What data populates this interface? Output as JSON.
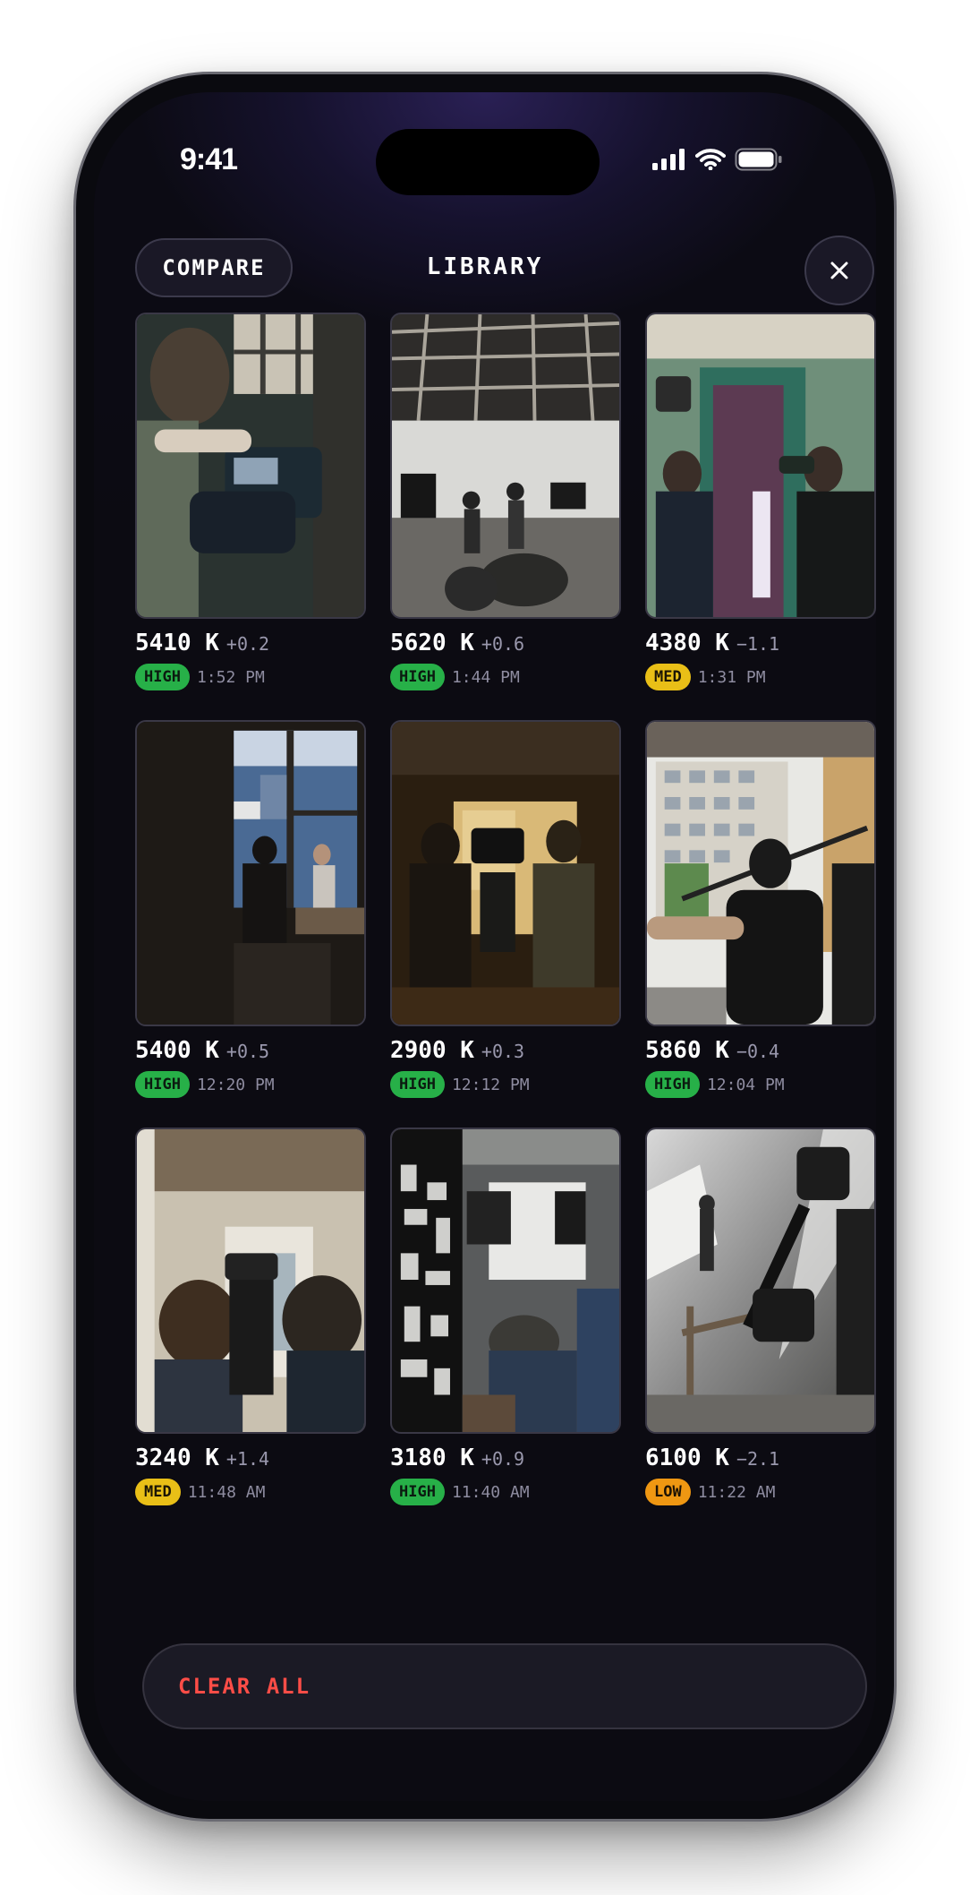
{
  "status_bar": {
    "time": "9:41"
  },
  "header": {
    "compare_label": "COMPARE",
    "title": "LIBRARY",
    "close_icon": "close-icon"
  },
  "colors": {
    "high": "#27b048",
    "med": "#e9bf17",
    "low": "#ef9712",
    "danger": "#ff4d47",
    "accent_bg": "#2a2055"
  },
  "items": [
    {
      "kelvin": "5410 K",
      "delta": "+0.2",
      "badge": "HIGH",
      "level": "high",
      "time": "1:52 PM"
    },
    {
      "kelvin": "5620 K",
      "delta": "+0.6",
      "badge": "HIGH",
      "level": "high",
      "time": "1:44 PM"
    },
    {
      "kelvin": "4380 K",
      "delta": "−1.1",
      "badge": "MED",
      "level": "med",
      "time": "1:31 PM"
    },
    {
      "kelvin": "5400 K",
      "delta": "+0.5",
      "badge": "HIGH",
      "level": "high",
      "time": "12:20 PM"
    },
    {
      "kelvin": "2900 K",
      "delta": "+0.3",
      "badge": "HIGH",
      "level": "high",
      "time": "12:12 PM"
    },
    {
      "kelvin": "5860 K",
      "delta": "−0.4",
      "badge": "HIGH",
      "level": "high",
      "time": "12:04 PM"
    },
    {
      "kelvin": "3240 K",
      "delta": "+1.4",
      "badge": "MED",
      "level": "med",
      "time": "11:48 AM"
    },
    {
      "kelvin": "3180 K",
      "delta": "+0.9",
      "badge": "HIGH",
      "level": "high",
      "time": "11:40 AM"
    },
    {
      "kelvin": "6100 K",
      "delta": "−2.1",
      "badge": "LOW",
      "level": "low",
      "time": "11:22 AM"
    }
  ],
  "footer": {
    "clear_label": "CLEAR ALL"
  }
}
